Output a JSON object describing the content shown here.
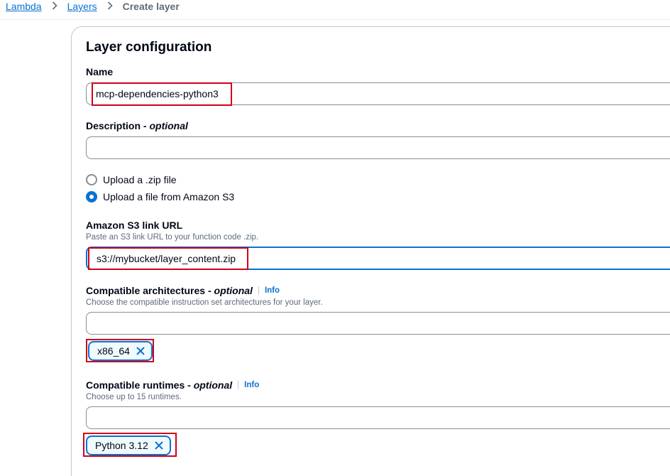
{
  "breadcrumb": {
    "items": [
      "Lambda",
      "Layers"
    ],
    "current": "Create layer"
  },
  "heading": "Layer configuration",
  "name": {
    "label": "Name",
    "value": "mcp-dependencies-python3"
  },
  "description": {
    "label": "Description",
    "optional": "optional",
    "value": ""
  },
  "upload_options": [
    {
      "label": "Upload a .zip file",
      "selected": false
    },
    {
      "label": "Upload a file from Amazon S3",
      "selected": true
    }
  ],
  "s3_url": {
    "label": "Amazon S3 link URL",
    "description": "Paste an S3 link URL to your function code .zip.",
    "value": "s3://mybucket/layer_content.zip"
  },
  "architectures": {
    "label": "Compatible architectures",
    "optional": "optional",
    "info": "Info",
    "description": "Choose the compatible instruction set architectures for your layer.",
    "tokens": [
      "x86_64"
    ]
  },
  "runtimes": {
    "label": "Compatible runtimes",
    "optional": "optional",
    "info": "Info",
    "description": "Choose up to 15 runtimes.",
    "tokens": [
      "Python 3.12"
    ]
  },
  "colors": {
    "accent": "#0972d3",
    "highlight": "#d0021b",
    "token_bg": "#f0fbff"
  }
}
